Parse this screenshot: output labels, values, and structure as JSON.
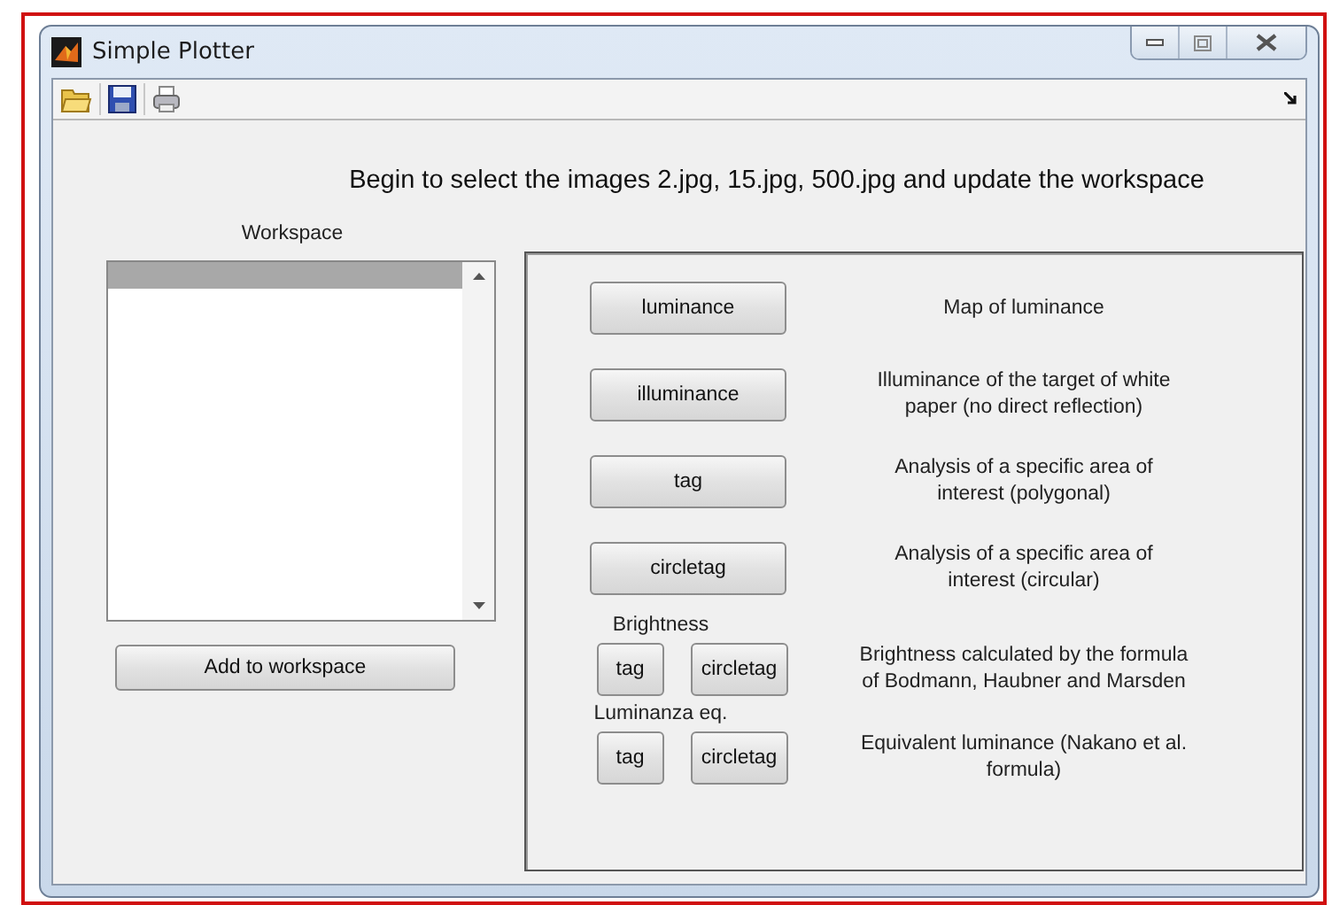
{
  "window": {
    "title": "Simple Plotter"
  },
  "instruction": "Begin to select the images 2.jpg, 15.jpg, 500.jpg and update the workspace",
  "workspace": {
    "label": "Workspace",
    "items": [
      {
        "selected": true
      }
    ],
    "button": "Add to workspace"
  },
  "tools": [
    {
      "kind": "single",
      "buttons": [
        "luminance"
      ],
      "description": [
        "Map of luminance"
      ]
    },
    {
      "kind": "single",
      "buttons": [
        "illuminance"
      ],
      "description": [
        "Illuminance of the target of white",
        "paper (no direct reflection)"
      ]
    },
    {
      "kind": "single",
      "buttons": [
        "tag"
      ],
      "description": [
        "Analysis of a specific area of",
        "interest (polygonal)"
      ]
    },
    {
      "kind": "single",
      "buttons": [
        "circletag"
      ],
      "description": [
        "Analysis of a specific area of",
        "interest (circular)"
      ]
    },
    {
      "kind": "group",
      "heading": "Brightness",
      "buttons": [
        "tag",
        "circletag"
      ],
      "description": [
        "Brightness calculated by the formula",
        "of Bodmann, Haubner and Marsden"
      ]
    },
    {
      "kind": "group",
      "heading": "Luminanza eq.",
      "buttons": [
        "tag",
        "circletag"
      ],
      "description": [
        "Equivalent luminance (Nakano et al.",
        "formula)"
      ]
    }
  ]
}
